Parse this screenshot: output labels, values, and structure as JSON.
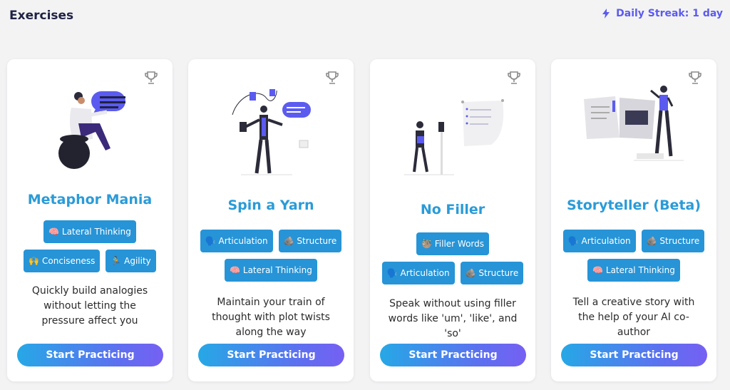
{
  "header": {
    "title": "Exercises",
    "streak_label": "Daily Streak: 1 day"
  },
  "cards": [
    {
      "title": "Metaphor Mania",
      "tags": [
        "🧠 Lateral Thinking",
        "🙌 Conciseness",
        "🏃 Agility"
      ],
      "description": "Quickly build analogies without letting the pressure affect you",
      "button": "Start Practicing"
    },
    {
      "title": "Spin a Yarn",
      "tags": [
        "🗣️ Articulation",
        "🪨 Structure",
        "🧠 Lateral Thinking"
      ],
      "description": "Maintain your train of thought with plot twists along the way",
      "button": "Start Practicing"
    },
    {
      "title": "No Filler",
      "tags": [
        "🦥 Filler Words",
        "🗣️ Articulation",
        "🪨 Structure"
      ],
      "description": "Speak without using filler words like 'um', 'like', and 'so'",
      "button": "Start Practicing"
    },
    {
      "title": "Storyteller (Beta)",
      "tags": [
        "🗣️ Articulation",
        "🪨 Structure",
        "🧠 Lateral Thinking"
      ],
      "description": "Tell a creative story with the help of your AI co-author",
      "button": "Start Practicing"
    }
  ],
  "colors": {
    "accent": "#2a9bd8",
    "streak": "#5b5bf0",
    "tag_bg": "#2694d7",
    "button_gradient_start": "#26a8e6",
    "button_gradient_end": "#7660f3"
  }
}
